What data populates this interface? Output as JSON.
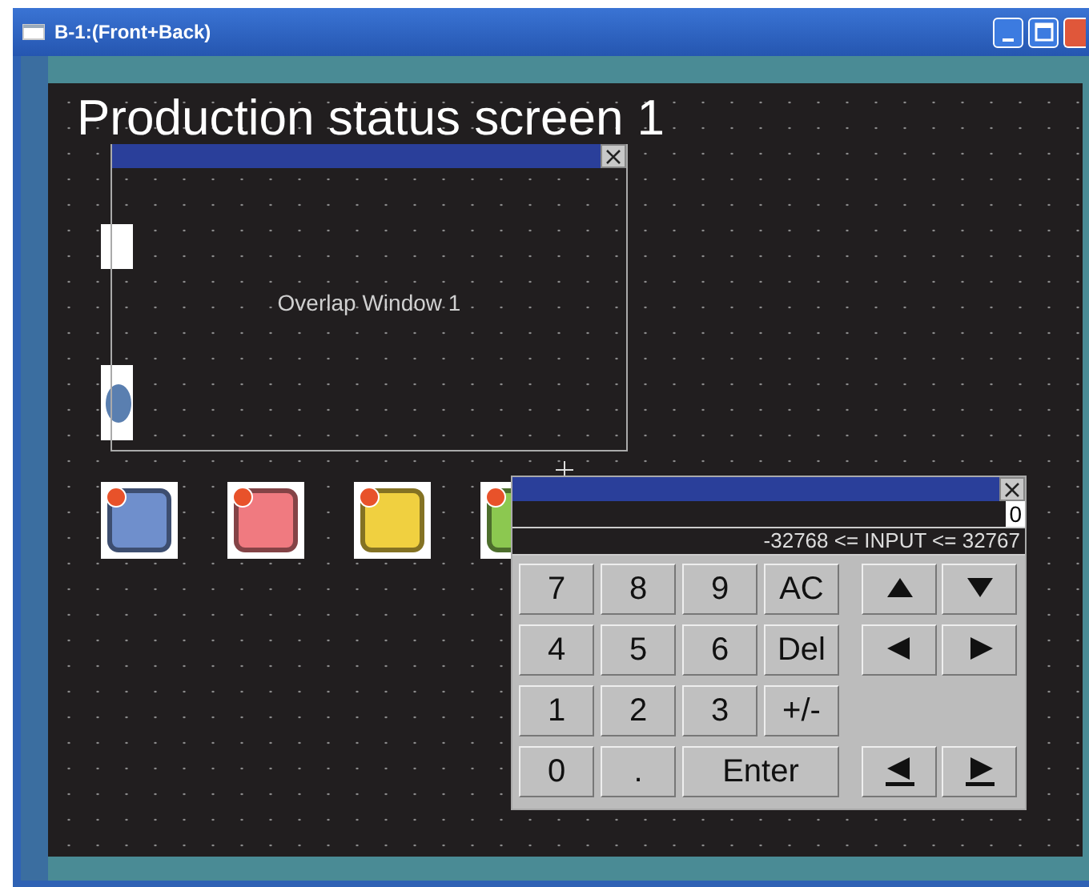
{
  "window": {
    "title": "B-1:(Front+Back)"
  },
  "screen": {
    "title": "Production status screen 1"
  },
  "lamps": [
    {
      "color": "#6f8fcc"
    },
    {
      "color": "#f07a80"
    },
    {
      "color": "#f0d040"
    },
    {
      "color": "#8cc850"
    }
  ],
  "overlap_window": {
    "label": "Overlap Window 1"
  },
  "keypad": {
    "value": "0",
    "range": "-32768 <= INPUT <= 32767",
    "keys": [
      {
        "kind": "text",
        "label": "7"
      },
      {
        "kind": "text",
        "label": "8"
      },
      {
        "kind": "text",
        "label": "9"
      },
      {
        "kind": "text",
        "label": "AC"
      },
      {
        "kind": "text",
        "label": "4"
      },
      {
        "kind": "text",
        "label": "5"
      },
      {
        "kind": "text",
        "label": "6"
      },
      {
        "kind": "text",
        "label": "Del"
      },
      {
        "kind": "text",
        "label": "1"
      },
      {
        "kind": "text",
        "label": "2"
      },
      {
        "kind": "text",
        "label": "3"
      },
      {
        "kind": "text",
        "label": "+/-"
      },
      {
        "kind": "text",
        "label": "0"
      },
      {
        "kind": "text",
        "label": "."
      },
      {
        "kind": "wide",
        "label": "Enter"
      }
    ],
    "arrows": [
      {
        "kind": "up"
      },
      {
        "kind": "down"
      },
      {
        "kind": "left"
      },
      {
        "kind": "right"
      },
      {
        "kind": "left_end"
      },
      {
        "kind": "right_end"
      }
    ]
  }
}
